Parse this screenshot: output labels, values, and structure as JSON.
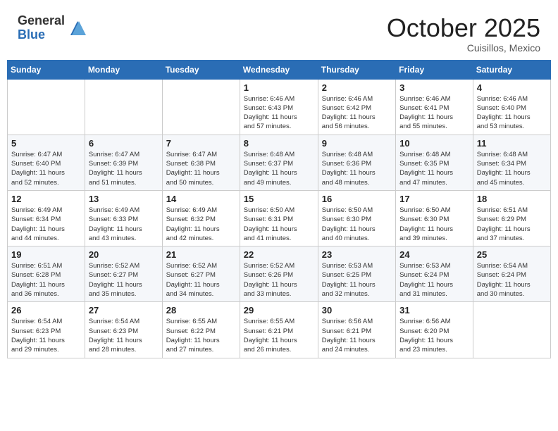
{
  "header": {
    "logo_general": "General",
    "logo_blue": "Blue",
    "month": "October 2025",
    "location": "Cuisillos, Mexico"
  },
  "days_of_week": [
    "Sunday",
    "Monday",
    "Tuesday",
    "Wednesday",
    "Thursday",
    "Friday",
    "Saturday"
  ],
  "weeks": [
    [
      {
        "day": "",
        "info": ""
      },
      {
        "day": "",
        "info": ""
      },
      {
        "day": "",
        "info": ""
      },
      {
        "day": "1",
        "info": "Sunrise: 6:46 AM\nSunset: 6:43 PM\nDaylight: 11 hours\nand 57 minutes."
      },
      {
        "day": "2",
        "info": "Sunrise: 6:46 AM\nSunset: 6:42 PM\nDaylight: 11 hours\nand 56 minutes."
      },
      {
        "day": "3",
        "info": "Sunrise: 6:46 AM\nSunset: 6:41 PM\nDaylight: 11 hours\nand 55 minutes."
      },
      {
        "day": "4",
        "info": "Sunrise: 6:46 AM\nSunset: 6:40 PM\nDaylight: 11 hours\nand 53 minutes."
      }
    ],
    [
      {
        "day": "5",
        "info": "Sunrise: 6:47 AM\nSunset: 6:40 PM\nDaylight: 11 hours\nand 52 minutes."
      },
      {
        "day": "6",
        "info": "Sunrise: 6:47 AM\nSunset: 6:39 PM\nDaylight: 11 hours\nand 51 minutes."
      },
      {
        "day": "7",
        "info": "Sunrise: 6:47 AM\nSunset: 6:38 PM\nDaylight: 11 hours\nand 50 minutes."
      },
      {
        "day": "8",
        "info": "Sunrise: 6:48 AM\nSunset: 6:37 PM\nDaylight: 11 hours\nand 49 minutes."
      },
      {
        "day": "9",
        "info": "Sunrise: 6:48 AM\nSunset: 6:36 PM\nDaylight: 11 hours\nand 48 minutes."
      },
      {
        "day": "10",
        "info": "Sunrise: 6:48 AM\nSunset: 6:35 PM\nDaylight: 11 hours\nand 47 minutes."
      },
      {
        "day": "11",
        "info": "Sunrise: 6:48 AM\nSunset: 6:34 PM\nDaylight: 11 hours\nand 45 minutes."
      }
    ],
    [
      {
        "day": "12",
        "info": "Sunrise: 6:49 AM\nSunset: 6:34 PM\nDaylight: 11 hours\nand 44 minutes."
      },
      {
        "day": "13",
        "info": "Sunrise: 6:49 AM\nSunset: 6:33 PM\nDaylight: 11 hours\nand 43 minutes."
      },
      {
        "day": "14",
        "info": "Sunrise: 6:49 AM\nSunset: 6:32 PM\nDaylight: 11 hours\nand 42 minutes."
      },
      {
        "day": "15",
        "info": "Sunrise: 6:50 AM\nSunset: 6:31 PM\nDaylight: 11 hours\nand 41 minutes."
      },
      {
        "day": "16",
        "info": "Sunrise: 6:50 AM\nSunset: 6:30 PM\nDaylight: 11 hours\nand 40 minutes."
      },
      {
        "day": "17",
        "info": "Sunrise: 6:50 AM\nSunset: 6:30 PM\nDaylight: 11 hours\nand 39 minutes."
      },
      {
        "day": "18",
        "info": "Sunrise: 6:51 AM\nSunset: 6:29 PM\nDaylight: 11 hours\nand 37 minutes."
      }
    ],
    [
      {
        "day": "19",
        "info": "Sunrise: 6:51 AM\nSunset: 6:28 PM\nDaylight: 11 hours\nand 36 minutes."
      },
      {
        "day": "20",
        "info": "Sunrise: 6:52 AM\nSunset: 6:27 PM\nDaylight: 11 hours\nand 35 minutes."
      },
      {
        "day": "21",
        "info": "Sunrise: 6:52 AM\nSunset: 6:27 PM\nDaylight: 11 hours\nand 34 minutes."
      },
      {
        "day": "22",
        "info": "Sunrise: 6:52 AM\nSunset: 6:26 PM\nDaylight: 11 hours\nand 33 minutes."
      },
      {
        "day": "23",
        "info": "Sunrise: 6:53 AM\nSunset: 6:25 PM\nDaylight: 11 hours\nand 32 minutes."
      },
      {
        "day": "24",
        "info": "Sunrise: 6:53 AM\nSunset: 6:24 PM\nDaylight: 11 hours\nand 31 minutes."
      },
      {
        "day": "25",
        "info": "Sunrise: 6:54 AM\nSunset: 6:24 PM\nDaylight: 11 hours\nand 30 minutes."
      }
    ],
    [
      {
        "day": "26",
        "info": "Sunrise: 6:54 AM\nSunset: 6:23 PM\nDaylight: 11 hours\nand 29 minutes."
      },
      {
        "day": "27",
        "info": "Sunrise: 6:54 AM\nSunset: 6:23 PM\nDaylight: 11 hours\nand 28 minutes."
      },
      {
        "day": "28",
        "info": "Sunrise: 6:55 AM\nSunset: 6:22 PM\nDaylight: 11 hours\nand 27 minutes."
      },
      {
        "day": "29",
        "info": "Sunrise: 6:55 AM\nSunset: 6:21 PM\nDaylight: 11 hours\nand 26 minutes."
      },
      {
        "day": "30",
        "info": "Sunrise: 6:56 AM\nSunset: 6:21 PM\nDaylight: 11 hours\nand 24 minutes."
      },
      {
        "day": "31",
        "info": "Sunrise: 6:56 AM\nSunset: 6:20 PM\nDaylight: 11 hours\nand 23 minutes."
      },
      {
        "day": "",
        "info": ""
      }
    ]
  ]
}
